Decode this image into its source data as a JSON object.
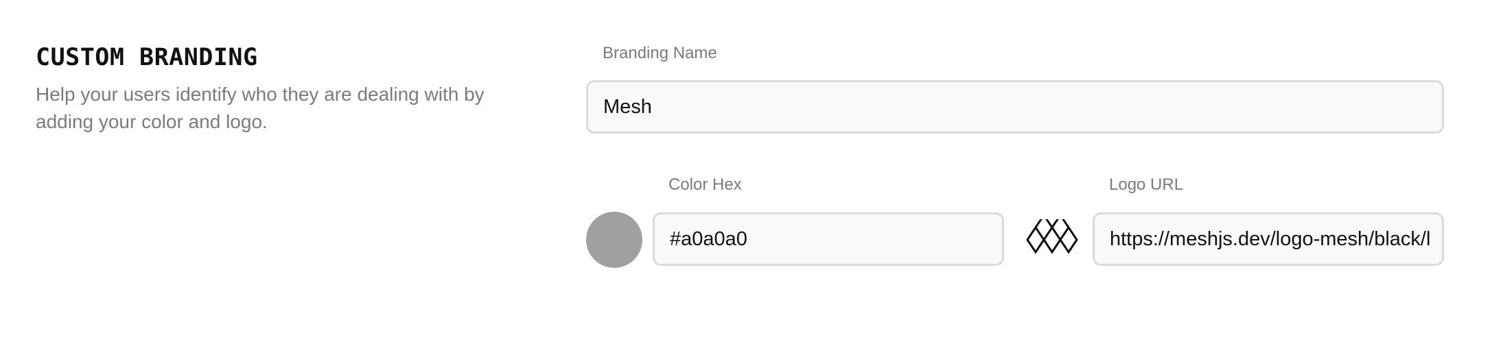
{
  "section": {
    "title": "CUSTOM BRANDING",
    "description": "Help your users identify who they are dealing with by adding your color and logo."
  },
  "branding_name": {
    "label": "Branding Name",
    "value": "Mesh"
  },
  "color_hex": {
    "label": "Color Hex",
    "value": "#a0a0a0",
    "swatch_color": "#a0a0a0"
  },
  "logo_url": {
    "label": "Logo URL",
    "value": "https://meshjs.dev/logo-mesh/black/l",
    "preview_icon": "mesh-logo-icon"
  }
}
